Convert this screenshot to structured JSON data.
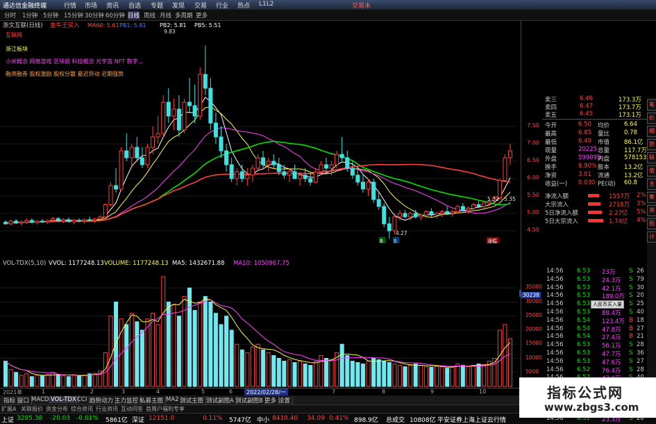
{
  "app": {
    "title": "通达信金融终端",
    "menu": [
      "行情",
      "市场",
      "资讯",
      "自选",
      "专题",
      "发现",
      "交易",
      "行业",
      "热点",
      "L1L2"
    ],
    "trade_label": "交易未"
  },
  "toolbar": {
    "periods": [
      "分时",
      "1分钟",
      "5分钟",
      "15分钟",
      "30分钟",
      "60分钟",
      "日线",
      "周线",
      "月线",
      "多周期",
      "更多"
    ]
  },
  "stock": {
    "name": "浙文互联(日线)",
    "signal": "金牛王买入",
    "indicators": [
      {
        "label": "MA60: 5.61",
        "color": "#ff4040"
      },
      {
        "label": "PB1: 5.81",
        "color": "#4080ff"
      },
      {
        "label": "PB2: 5.81",
        "color": "#ffffff"
      },
      {
        "label": "PB5: 5.51",
        "color": "#ffffff"
      }
    ],
    "concepts": [
      {
        "text": "互联网",
        "color": "#ff4040"
      },
      {
        "text": "浙江板块",
        "color": "#ffff40"
      },
      {
        "text": "小米概念 网络游戏 区块链 科技概念 元宇宙 NFT 数字...",
        "color": "#ff40ff"
      },
      {
        "text": "融资融券 股权激励 股权分散 最近异动 近期强势",
        "color": "#ffa040"
      }
    ],
    "hi_label": "9.83",
    "lo_label": "4.27",
    "ma_label": "5.32 - 5.35",
    "marker_buy": "B",
    "marker_sell": "S",
    "marker_mid": "买",
    "marker_end": "涨幅"
  },
  "volume_header": {
    "items": [
      {
        "text": "VOL-TDX(5,10)",
        "color": "#cccccc"
      },
      {
        "text": "VVOL: 1177248.13",
        "color": "#ffffff"
      },
      {
        "text": "VOLUME: 1177248.13",
        "color": "#ffff40"
      },
      {
        "text": "MA5: 1432671.88",
        "color": "#ffffff"
      },
      {
        "text": "MA10: 1050967.75",
        "color": "#ff40ff"
      }
    ]
  },
  "volume_axis": {
    "ticks": [
      "35000",
      "30000",
      "25000",
      "20000",
      "15000",
      "10000",
      "5000"
    ],
    "highlight": "30238"
  },
  "price_axis": {
    "ticks": [
      "7.50",
      "7.00",
      "6.50",
      "6.00",
      "5.50",
      "5.00",
      "4.50"
    ]
  },
  "date_axis": {
    "labels": [
      "2021年",
      "1",
      "2",
      "3",
      "4",
      "5",
      "6",
      "2022/02/28/一",
      "7",
      "8",
      "9",
      "10"
    ]
  },
  "bottom_tabs": [
    "指标",
    "窗口",
    "MACD",
    "VOL-TDX",
    "CCI",
    "趋势动力",
    "主力监控",
    "私募主图",
    "MA2",
    "测试主图",
    "测试副图A",
    "测试副图B",
    "更多",
    "设置"
  ],
  "ext_bar": {
    "items": [
      "扩展A",
      "关联报价",
      "资金分布",
      "综合资讯",
      "行业资讯",
      "互动问答",
      "首周户福利专享"
    ]
  },
  "status_bar": {
    "items": [
      {
        "text": "上证",
        "color": "#ffffff"
      },
      {
        "text": "3285.38",
        "color": "#00e000"
      },
      {
        "text": "-20.03",
        "color": "#00e000"
      },
      {
        "text": "-0.61%",
        "color": "#00e000"
      },
      {
        "text": "5861亿",
        "color": "#ffffff"
      },
      {
        "text": "深证",
        "color": "#ffffff"
      },
      {
        "text": "12151.0",
        "color": "#ff4040"
      },
      {
        "text": "0.11%",
        "color": "#ff4040"
      },
      {
        "text": "5747亿",
        "color": "#ffffff"
      },
      {
        "text": "中小",
        "color": "#ffffff"
      },
      {
        "text": "8410.40",
        "color": "#ff4040"
      },
      {
        "text": "34.09",
        "color": "#ff4040"
      },
      {
        "text": "0.41%",
        "color": "#ff4040"
      },
      {
        "text": "898.9亿",
        "color": "#ffffff"
      },
      {
        "text": "总成交",
        "color": "#ffffff"
      },
      {
        "text": "10808亿",
        "color": "#ffffff"
      },
      {
        "text": "平安证券上海上证云行情",
        "color": "#ffffff"
      }
    ]
  },
  "right_panel": {
    "order_book": [
      {
        "label": "卖三",
        "price": "6.46",
        "vol": "173.3万"
      },
      {
        "label": "卖四",
        "price": "6.47",
        "vol": "173.7万"
      },
      {
        "label": "卖五",
        "price": "6.45",
        "vol": "173.1万"
      }
    ],
    "stats": [
      {
        "l1": "今开",
        "v1": "6.50",
        "l2": "均价",
        "v2": "6.64"
      },
      {
        "l1": "最高",
        "v1": "6.85",
        "l2": "量比",
        "v2": "0.78"
      },
      {
        "l1": "最低",
        "v1": "6.49",
        "l2": "市值",
        "v2": "86.1亿"
      },
      {
        "l1": "现量",
        "v1": "20225",
        "l2": "总量",
        "v2": "117.7万"
      },
      {
        "l1": "外盘",
        "v1": "599095",
        "l2": "内盘",
        "v2": "578153"
      },
      {
        "l1": "换手",
        "v1": "8.90%",
        "l2": "股本",
        "v2": "13.2亿"
      },
      {
        "l1": "净资",
        "v1": "3.01",
        "l2": "流通",
        "v2": "13.2亿"
      },
      {
        "l1": "收益(一)",
        "v1": "0.030",
        "l2": "PE(动)",
        "v2": "60.8"
      }
    ],
    "flows": [
      {
        "label": "净流入额",
        "val": "1557万",
        "pct": "2%"
      },
      {
        "label": "大宗流入",
        "val": "2718万",
        "pct": "3%"
      },
      {
        "label": "5日净流入额",
        "val": "2.27亿",
        "pct": "5%"
      },
      {
        "label": "5日大宗流入",
        "val": "1.74亿",
        "pct": "4%"
      }
    ],
    "ticks": [
      {
        "t": "14:56",
        "p": "6.53",
        "v": "23万",
        "d": "S",
        "n": "26"
      },
      {
        "t": "14:56",
        "p": "6.53",
        "v": "24.3万",
        "d": "S",
        "n": "79"
      },
      {
        "t": "14:56",
        "p": "6.53",
        "v": "42.1万",
        "d": "S",
        "n": "30"
      },
      {
        "t": "14:56",
        "p": "6.53",
        "v": "189.0万",
        "d": "S",
        "n": "20"
      },
      {
        "t": "14:56",
        "p": "6.53",
        "v": "66.5万",
        "d": "S",
        "n": "25"
      },
      {
        "t": "14:56",
        "p": "6.53",
        "v": "88.4万",
        "d": "S",
        "n": "40"
      },
      {
        "t": "14:56",
        "p": "6.54",
        "v": "123.4万",
        "d": "B",
        "n": "18"
      },
      {
        "t": "14:56",
        "p": "6.54",
        "v": "47.8万",
        "d": "B",
        "n": "27"
      },
      {
        "t": "14:56",
        "p": "6.54",
        "v": "27.4万",
        "d": "B",
        "n": "21"
      },
      {
        "t": "14:56",
        "p": "6.53",
        "v": "56.1万",
        "d": "S",
        "n": "28"
      },
      {
        "t": "14:56",
        "p": "6.53",
        "v": "47.7万",
        "d": "S",
        "n": "36"
      },
      {
        "t": "14:56",
        "p": "6.53",
        "v": "47.6万",
        "d": "S",
        "n": "27"
      },
      {
        "t": "14:56",
        "p": "6.52",
        "v": "76.4万",
        "d": "S",
        "n": "28"
      },
      {
        "t": "14:56",
        "p": "6.52",
        "v": "47.0万",
        "d": "S",
        "n": "40"
      },
      {
        "t": "14:56",
        "p": "6.53",
        "v": "24.1万",
        "d": "B",
        "n": "20"
      },
      {
        "t": "14:56",
        "p": "6.52",
        "v": "24.1万",
        "d": "S",
        "n": "11"
      },
      {
        "t": "14:56",
        "p": "6.52",
        "v": "22.1万",
        "d": "S",
        "n": "27"
      },
      {
        "t": "14:56",
        "p": "6.51",
        "v": "22.8万",
        "d": "S",
        "n": "21"
      },
      {
        "t": "14:56",
        "p": "6.51",
        "v": "23.3万",
        "d": "S",
        "n": "20"
      }
    ],
    "tooltip": "人民币买入量",
    "side_tabs": [
      "笔",
      "价",
      "细",
      "势",
      "联",
      "值",
      "主",
      "筹",
      "资",
      "图",
      "计"
    ]
  },
  "watermark": {
    "line1": "指标公式网",
    "line2": "www.zbgs3.com"
  },
  "chart_data": {
    "type": "candlestick",
    "title": "浙文互联(日线)",
    "ylim": [
      4.0,
      10.2
    ],
    "price_ticks": [
      7.5,
      7.0,
      6.5,
      6.0,
      5.5,
      5.0,
      4.5
    ],
    "candles": [
      [
        4.75,
        4.8,
        4.68,
        4.7
      ],
      [
        4.7,
        4.82,
        4.66,
        4.78
      ],
      [
        4.78,
        4.84,
        4.7,
        4.72
      ],
      [
        4.72,
        4.8,
        4.65,
        4.75
      ],
      [
        4.75,
        4.85,
        4.7,
        4.8
      ],
      [
        4.8,
        4.86,
        4.72,
        4.74
      ],
      [
        4.74,
        4.8,
        4.68,
        4.78
      ],
      [
        4.78,
        4.84,
        4.72,
        4.76
      ],
      [
        4.76,
        4.82,
        4.7,
        4.8
      ],
      [
        4.8,
        4.9,
        4.74,
        4.85
      ],
      [
        4.85,
        4.9,
        4.76,
        4.78
      ],
      [
        4.78,
        4.86,
        4.72,
        4.82
      ],
      [
        4.82,
        4.88,
        4.74,
        4.76
      ],
      [
        4.76,
        4.84,
        4.7,
        4.8
      ],
      [
        4.8,
        4.86,
        4.74,
        4.78
      ],
      [
        4.78,
        4.85,
        4.7,
        4.82
      ],
      [
        4.82,
        4.9,
        4.76,
        4.8
      ],
      [
        4.8,
        4.88,
        4.72,
        4.84
      ],
      [
        4.84,
        4.95,
        4.8,
        4.9
      ],
      [
        4.9,
        5.3,
        4.86,
        5.25
      ],
      [
        5.25,
        5.9,
        5.2,
        5.8
      ],
      [
        5.8,
        6.3,
        5.6,
        5.7
      ],
      [
        5.7,
        6.9,
        5.65,
        6.8
      ],
      [
        6.8,
        7.3,
        6.5,
        6.6
      ],
      [
        6.6,
        7.0,
        6.3,
        6.9
      ],
      [
        6.9,
        7.2,
        6.5,
        6.6
      ],
      [
        6.6,
        6.9,
        6.3,
        6.4
      ],
      [
        6.4,
        7.0,
        6.3,
        6.9
      ],
      [
        6.9,
        7.5,
        6.7,
        7.2
      ],
      [
        7.2,
        7.8,
        7.0,
        7.3
      ],
      [
        7.3,
        8.4,
        7.2,
        8.2
      ],
      [
        8.2,
        8.6,
        7.6,
        7.8
      ],
      [
        7.8,
        8.3,
        7.4,
        8.0
      ],
      [
        8.0,
        8.4,
        7.2,
        7.4
      ],
      [
        7.4,
        8.3,
        7.3,
        8.2
      ],
      [
        8.2,
        8.9,
        7.9,
        8.1
      ],
      [
        8.1,
        8.7,
        7.6,
        7.8
      ],
      [
        7.8,
        9.2,
        7.7,
        9.0
      ],
      [
        9.0,
        9.83,
        8.4,
        8.6
      ],
      [
        8.6,
        8.9,
        7.4,
        7.6
      ],
      [
        7.6,
        7.9,
        7.0,
        7.2
      ],
      [
        7.2,
        7.5,
        6.6,
        6.8
      ],
      [
        6.8,
        7.0,
        6.2,
        6.4
      ],
      [
        6.4,
        6.6,
        5.9,
        6.0
      ],
      [
        6.0,
        6.3,
        5.8,
        6.2
      ],
      [
        6.2,
        6.4,
        5.9,
        6.0
      ],
      [
        6.0,
        6.3,
        5.8,
        6.1
      ],
      [
        6.1,
        6.4,
        5.9,
        6.3
      ],
      [
        6.3,
        6.7,
        6.2,
        6.6
      ],
      [
        6.6,
        6.8,
        6.3,
        6.4
      ],
      [
        6.4,
        6.6,
        6.2,
        6.5
      ],
      [
        6.5,
        6.7,
        6.3,
        6.4
      ],
      [
        6.4,
        6.6,
        6.1,
        6.2
      ],
      [
        6.2,
        6.4,
        6.0,
        6.1
      ],
      [
        6.1,
        6.3,
        5.9,
        6.2
      ],
      [
        6.2,
        6.4,
        6.0,
        6.0
      ],
      [
        6.0,
        6.2,
        5.8,
        6.1
      ],
      [
        6.1,
        6.3,
        5.9,
        6.0
      ],
      [
        6.0,
        6.2,
        5.8,
        5.9
      ],
      [
        5.9,
        6.3,
        5.85,
        6.2
      ],
      [
        6.2,
        6.5,
        6.1,
        6.4
      ],
      [
        6.4,
        6.6,
        6.2,
        6.3
      ],
      [
        6.3,
        6.5,
        6.1,
        6.4
      ],
      [
        6.4,
        6.8,
        6.3,
        6.7
      ],
      [
        6.7,
        7.2,
        6.5,
        6.6
      ],
      [
        6.6,
        6.8,
        6.2,
        6.3
      ],
      [
        6.3,
        6.5,
        6.0,
        6.1
      ],
      [
        6.1,
        6.3,
        5.8,
        5.9
      ],
      [
        5.9,
        6.1,
        5.6,
        5.7
      ],
      [
        5.7,
        6.0,
        5.5,
        5.9
      ],
      [
        5.9,
        6.0,
        5.3,
        5.4
      ],
      [
        5.4,
        5.6,
        5.1,
        5.2
      ],
      [
        5.2,
        5.3,
        4.6,
        4.7
      ],
      [
        4.7,
        4.9,
        4.27,
        4.5
      ],
      [
        4.5,
        5.0,
        4.4,
        4.9
      ],
      [
        4.9,
        5.1,
        4.8,
        5.0
      ],
      [
        5.0,
        5.1,
        4.85,
        4.9
      ],
      [
        4.9,
        5.05,
        4.8,
        5.0
      ],
      [
        5.0,
        5.1,
        4.85,
        4.9
      ],
      [
        4.9,
        5.0,
        4.8,
        4.95
      ],
      [
        4.95,
        5.1,
        4.85,
        5.05
      ],
      [
        5.05,
        5.15,
        4.9,
        4.95
      ],
      [
        4.95,
        5.05,
        4.85,
        5.0
      ],
      [
        5.0,
        5.1,
        4.9,
        5.05
      ],
      [
        5.05,
        5.2,
        4.95,
        5.0
      ],
      [
        5.0,
        5.1,
        4.9,
        5.05
      ],
      [
        5.05,
        5.25,
        5.0,
        5.2
      ],
      [
        5.2,
        5.3,
        5.05,
        5.1
      ],
      [
        5.1,
        5.2,
        5.0,
        5.15
      ],
      [
        5.15,
        5.3,
        5.1,
        5.25
      ],
      [
        5.25,
        5.35,
        5.15,
        5.2
      ],
      [
        5.2,
        5.32,
        5.1,
        5.3
      ],
      [
        5.3,
        5.4,
        5.2,
        5.35
      ],
      [
        5.35,
        5.5,
        5.3,
        5.45
      ],
      [
        5.45,
        6.0,
        5.4,
        5.95
      ],
      [
        5.95,
        6.7,
        5.9,
        6.6
      ],
      [
        6.6,
        7.0,
        6.4,
        6.8
      ]
    ],
    "volumes": [
      9000,
      6000,
      5000,
      4000,
      4500,
      3500,
      4000,
      3800,
      4200,
      5000,
      4000,
      3800,
      3500,
      4200,
      3900,
      4100,
      4500,
      4600,
      5500,
      12000,
      25000,
      30000,
      24000,
      22000,
      26000,
      23000,
      20000,
      24000,
      26000,
      22000,
      39000,
      30000,
      29000,
      25000,
      32000,
      35000,
      27000,
      30000,
      32000,
      30000,
      26000,
      22000,
      25000,
      20000,
      15000,
      13000,
      12000,
      14000,
      15000,
      13000,
      12000,
      11000,
      10000,
      9000,
      9500,
      8500,
      9000,
      8000,
      7500,
      9000,
      11000,
      10000,
      9500,
      12000,
      15000,
      11000,
      9000,
      8500,
      8000,
      9000,
      10000,
      9500,
      9000,
      8500,
      8000,
      7500,
      7000,
      7500,
      8000,
      7500,
      7000,
      6800,
      7200,
      7000,
      6500,
      7000,
      8000,
      7500,
      7000,
      7500,
      8000,
      7800,
      9000,
      10000,
      20000,
      22000,
      17000
    ],
    "vol_ticks": [
      35000,
      30000,
      25000,
      20000,
      15000,
      10000,
      5000
    ]
  }
}
